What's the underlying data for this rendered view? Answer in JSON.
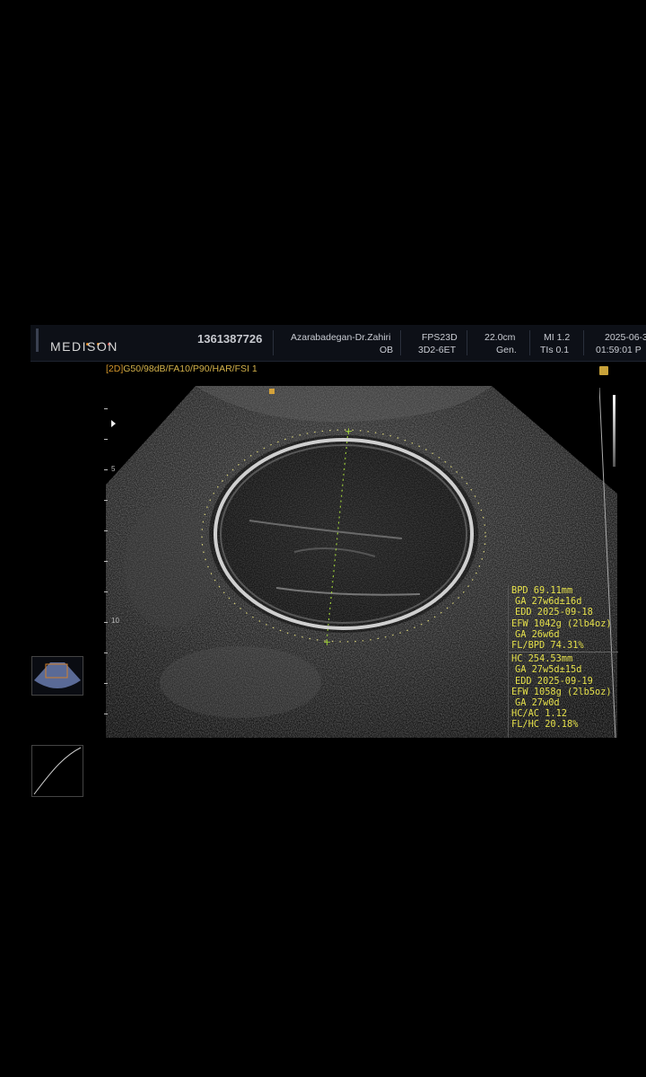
{
  "header": {
    "logo": "MEDISON",
    "patient_id": "1361387726",
    "doctor": "Azarabadegan-Dr.Zahiri",
    "exam_type": "OB",
    "fps": "FPS23D",
    "probe": "3D2-6ET",
    "depth": "22.0cm",
    "freq": "Gen.",
    "mi": "MI 1.2",
    "tis": "TIs 0.1",
    "date": "2025-06-3",
    "time": "01:59:01 P",
    "logo_dot_colors": [
      "#e5902a",
      "#e5902a",
      "#d6403a"
    ]
  },
  "preset": {
    "mode": "[2D]",
    "params": "G50/98dB/FA10/P90/HAR/FSI 1"
  },
  "depth_scale": {
    "labels": [
      "5",
      "10"
    ]
  },
  "measurements": {
    "bpd": "BPD 69.11mm",
    "bpd_ga": "GA 27w6d±16d",
    "bpd_edd": "EDD 2025-09-18",
    "efw1": "EFW 1042g (2lb4oz)",
    "efw1_ga": "GA 26w6d",
    "fl_bpd": "FL/BPD 74.31%",
    "hc": "HC  254.53mm",
    "hc_ga": "GA 27w5d±15d",
    "hc_edd": "EDD 2025-09-19",
    "efw2": "EFW 1058g (2lb5oz)",
    "efw2_ga": "GA 27w0d",
    "hc_ac": "HC/AC 1.12",
    "fl_hc": "FL/HC 20.18%"
  },
  "colors": {
    "measure_text": "#e5e04a",
    "caliper": "#9ccc3a",
    "preset_text": "#d4b24a"
  }
}
